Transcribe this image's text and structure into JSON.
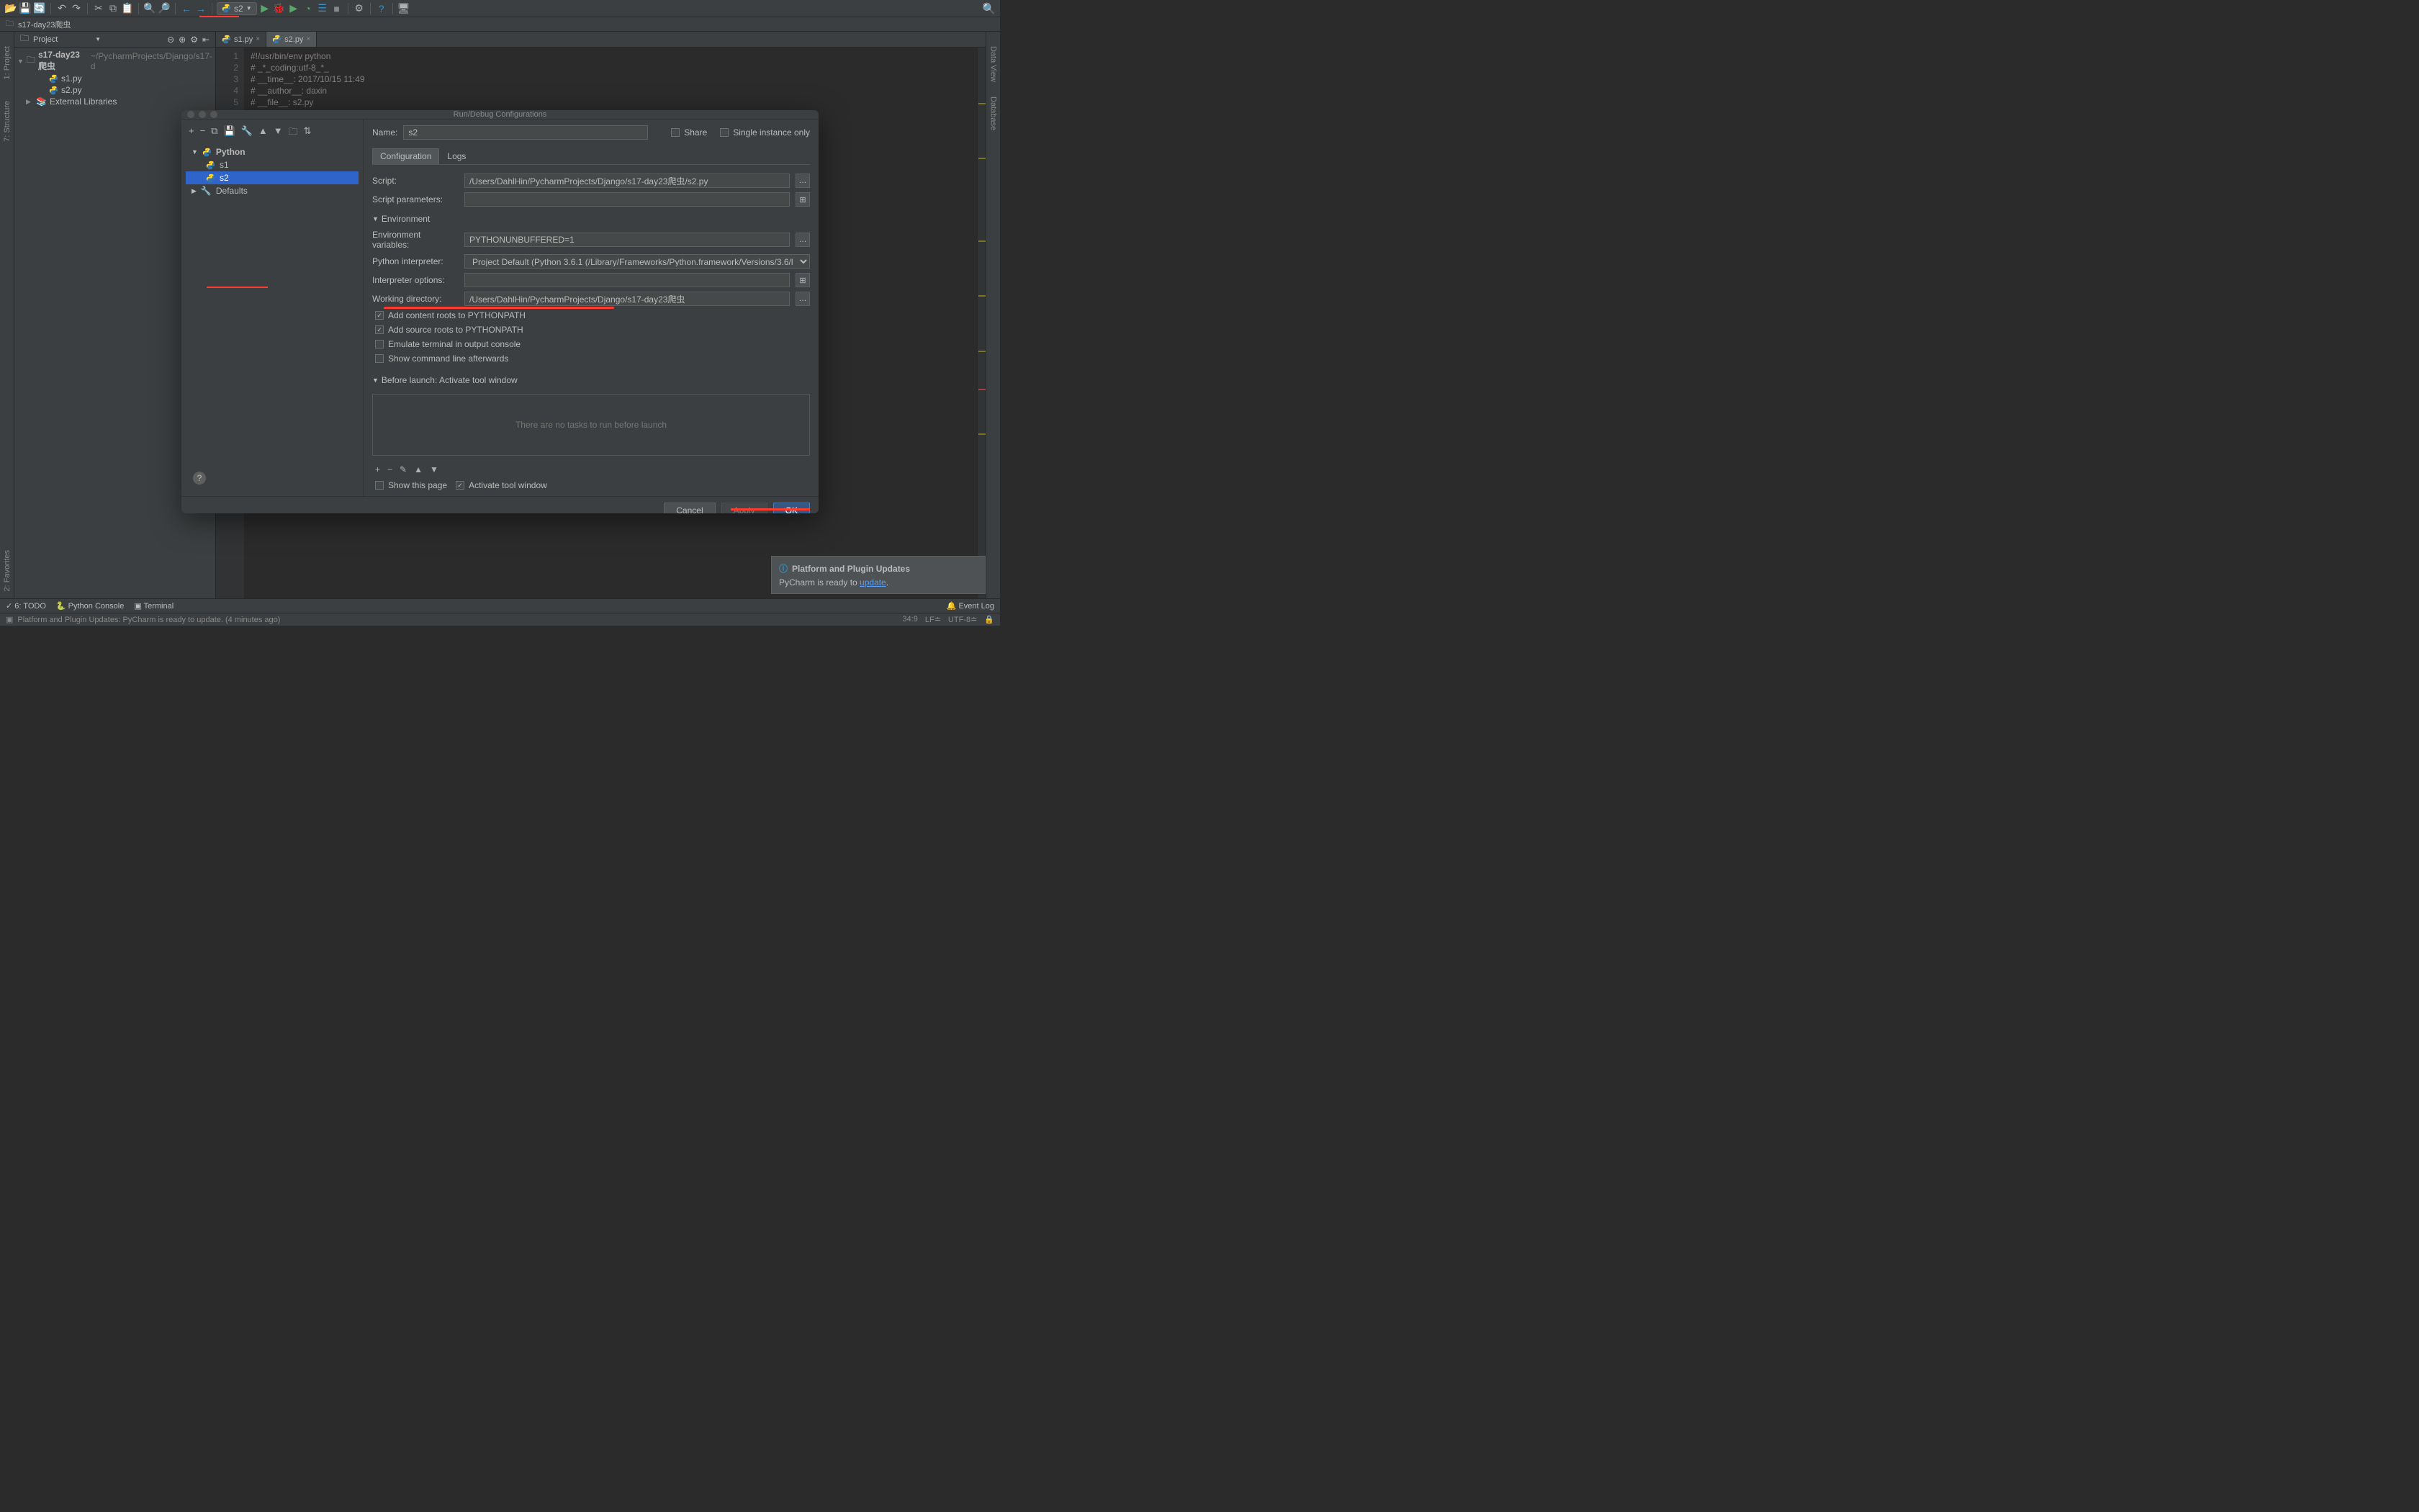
{
  "toolbar": {
    "run_config": "s2"
  },
  "breadcrumb": {
    "project": "s17-day23爬虫"
  },
  "panel": {
    "title": "Project",
    "root_name": "s17-day23爬虫",
    "root_path": "~/PycharmProjects/Django/s17-d",
    "files": [
      "s1.py",
      "s2.py"
    ],
    "external": "External Libraries"
  },
  "tabs": [
    {
      "name": "s1.py",
      "active": false
    },
    {
      "name": "s2.py",
      "active": true
    }
  ],
  "code_lines": [
    "#!/usr/bin/env python",
    "# _*_coding:utf-8_*_",
    "# __time__: 2017/10/15 11:49",
    "# __author__: daxin",
    "# __file__: s2.py"
  ],
  "left_gutter": [
    "1: Project",
    "7: Structure"
  ],
  "right_gutter": [
    "Data View",
    "Database"
  ],
  "bottom_left_gutter": "2: Favorites",
  "dialog": {
    "title": "Run/Debug Configurations",
    "name_label": "Name:",
    "name_value": "s2",
    "share": "Share",
    "single_instance": "Single instance only",
    "tabs": [
      "Configuration",
      "Logs"
    ],
    "tree": {
      "python": "Python",
      "items": [
        "s1",
        "s2"
      ],
      "defaults": "Defaults"
    },
    "fields": {
      "script_label": "Script:",
      "script_value": "/Users/DahlHin/PycharmProjects/Django/s17-day23爬虫/s2.py",
      "params_label": "Script parameters:",
      "params_value": "",
      "env_section": "Environment",
      "envvars_label": "Environment variables:",
      "envvars_value": "PYTHONUNBUFFERED=1",
      "interp_label": "Python interpreter:",
      "interp_value": "Project Default (Python 3.6.1 (/Library/Frameworks/Python.framework/Versions/3.6/l",
      "interp_opts_label": "Interpreter options:",
      "interp_opts_value": "",
      "workdir_label": "Working directory:",
      "workdir_value": "/Users/DahlHin/PycharmProjects/Django/s17-day23爬虫",
      "add_content": "Add content roots to PYTHONPATH",
      "add_source": "Add source roots to PYTHONPATH",
      "emulate": "Emulate terminal in output console",
      "show_cmd": "Show command line afterwards",
      "before_launch": "Before launch: Activate tool window",
      "no_tasks": "There are no tasks to run before launch",
      "show_page": "Show this page",
      "activate_tw": "Activate tool window"
    },
    "buttons": {
      "cancel": "Cancel",
      "apply": "Apply",
      "ok": "OK"
    }
  },
  "bottom_bar": {
    "todo": "6: TODO",
    "console": "Python Console",
    "terminal": "Terminal",
    "event_log": "Event Log"
  },
  "status": {
    "msg": "Platform and Plugin Updates: PyCharm is ready to update. (4 minutes ago)",
    "pos": "34:9",
    "lf": "LF",
    "enc": "UTF-8",
    "lock": "🔒"
  },
  "notification": {
    "title": "Platform and Plugin Updates",
    "body_pre": "PyCharm is ready to ",
    "link": "update",
    "body_post": "."
  }
}
